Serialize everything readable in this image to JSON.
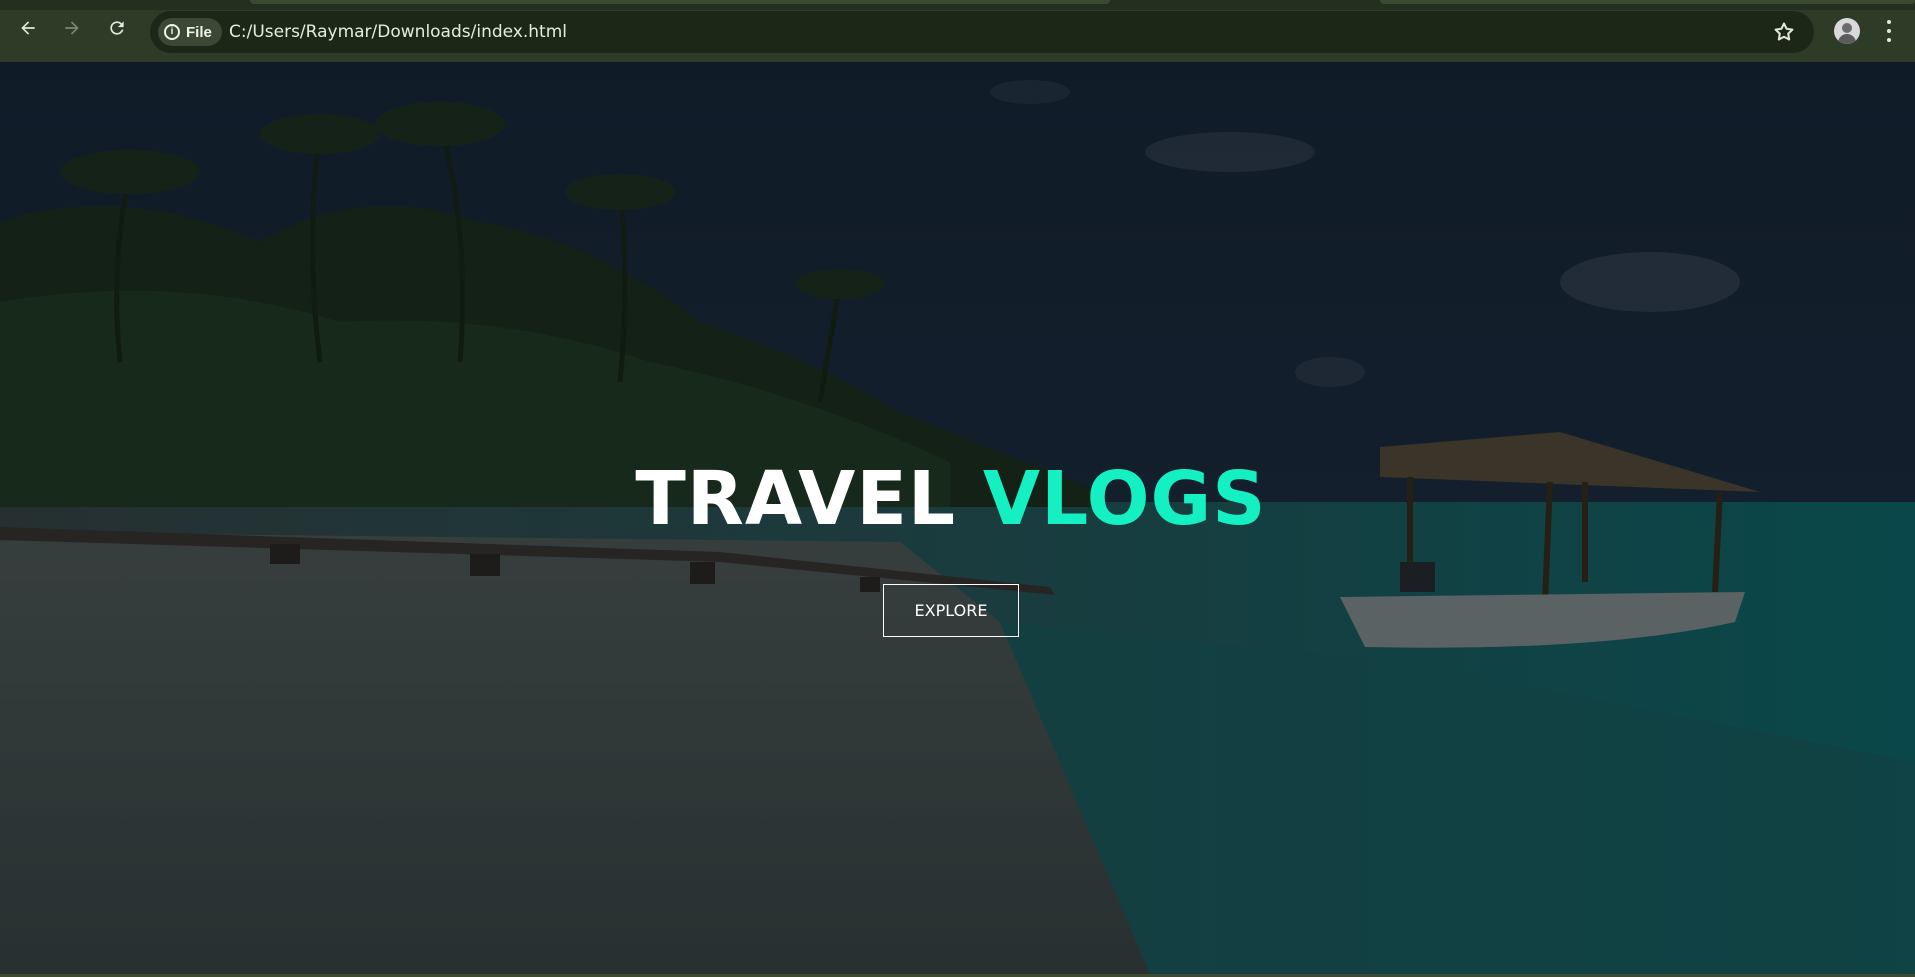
{
  "browser": {
    "site_chip_label": "File",
    "url": "C:/Users/Raymar/Downloads/index.html",
    "icons": {
      "back": "back-arrow-icon",
      "forward": "forward-arrow-icon",
      "reload": "reload-icon",
      "info": "info-icon",
      "bookmark": "star-icon",
      "profile": "avatar",
      "menu": "kebab-menu-icon"
    }
  },
  "hero": {
    "title_part1": "TRAVEL",
    "title_part2": "VLOGS",
    "button_label": "EXPLORE"
  },
  "colors": {
    "accent": "#14f0c2",
    "title_white": "#ffffff",
    "chrome_bg": "#2e3b27",
    "omnibox_bg": "#1d2718"
  }
}
